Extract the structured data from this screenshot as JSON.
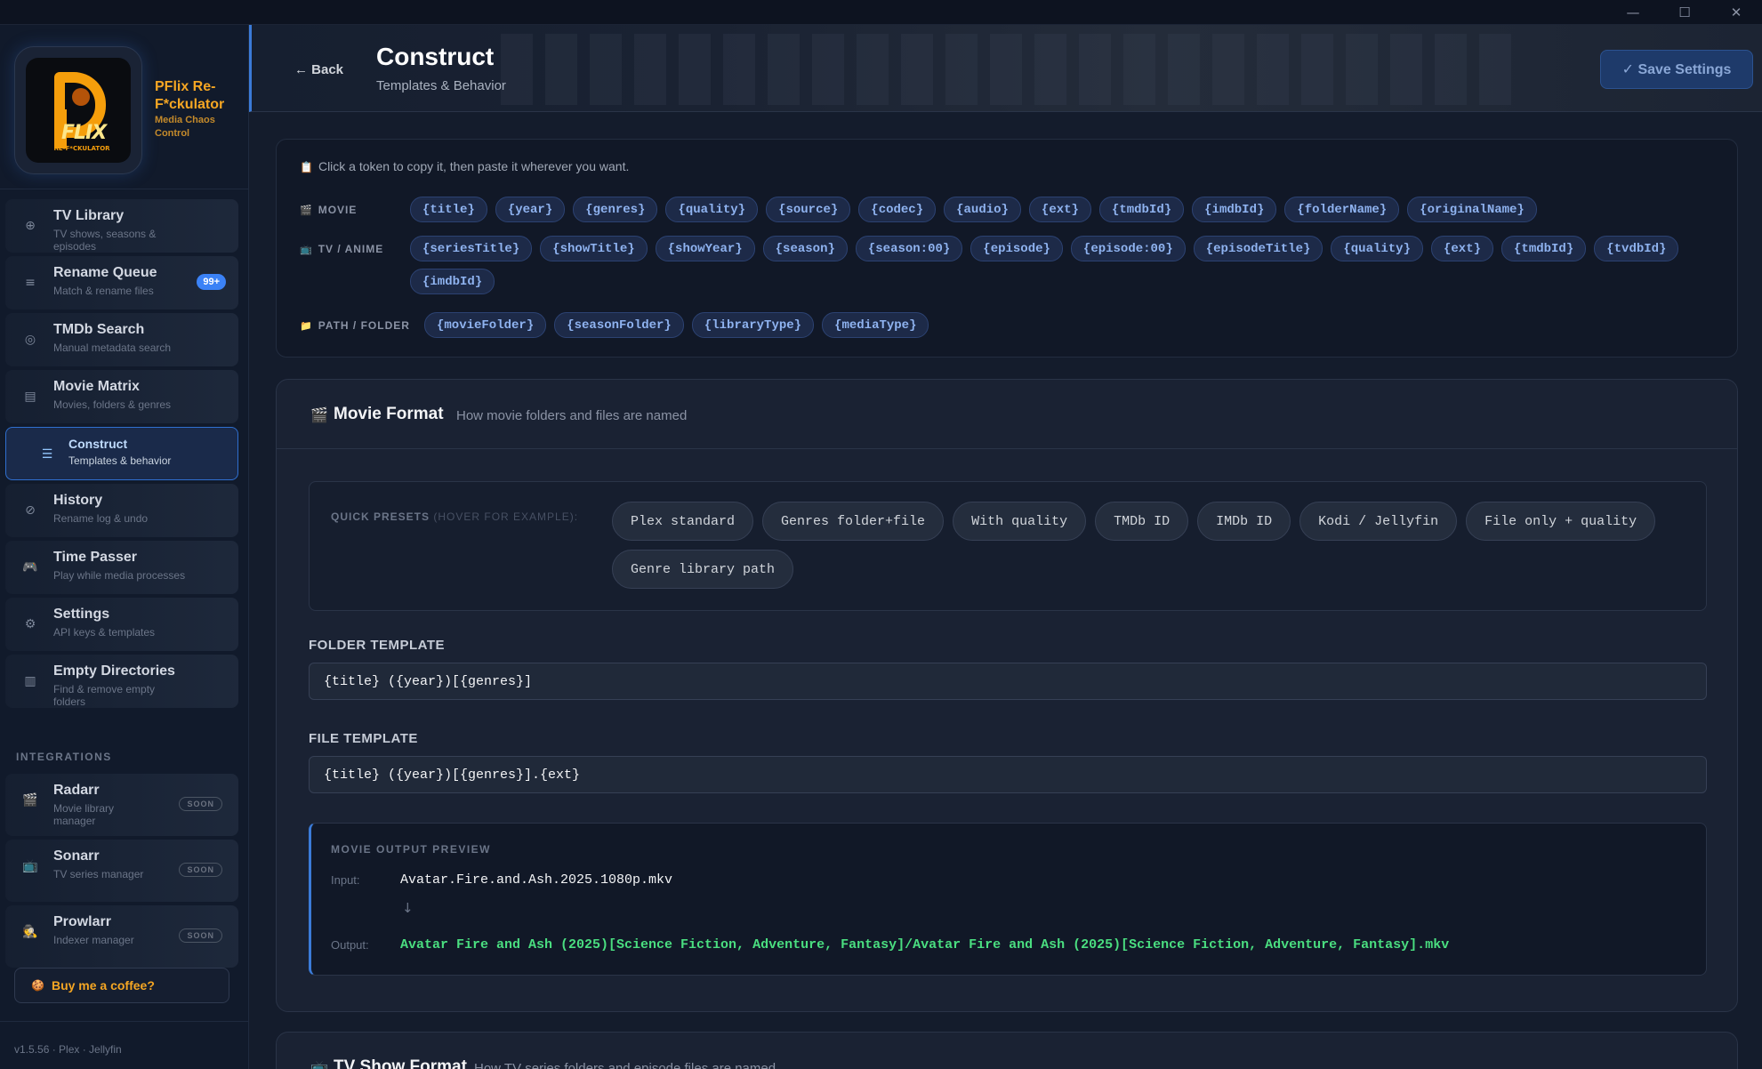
{
  "window": {
    "minimize": "—",
    "maximize": "☐",
    "close": "✕"
  },
  "brand": {
    "name": "PFlix Re-F*ckulator",
    "tagline": "Media Chaos Control",
    "logo_text": "FLIX",
    "logo_subtext": "RE-F*CKULATOR"
  },
  "nav": [
    {
      "label": "TV Library",
      "desc": "TV shows, seasons & episodes",
      "icon": "globe-icon",
      "glyph": "⊕"
    },
    {
      "label": "Rename Queue",
      "desc": "Match & rename files",
      "icon": "list-icon",
      "glyph": "≡",
      "badge": "99+"
    },
    {
      "label": "TMDb Search",
      "desc": "Manual metadata search",
      "icon": "target-icon",
      "glyph": "◎"
    },
    {
      "label": "Movie Matrix",
      "desc": "Movies, folders & genres",
      "icon": "grid-icon",
      "glyph": "▤"
    },
    {
      "label": "Construct",
      "desc": "Templates & behavior",
      "icon": "lines-icon",
      "glyph": "☰",
      "active": true
    },
    {
      "label": "History",
      "desc": "Rename log & undo",
      "icon": "clock-icon",
      "glyph": "⊘"
    },
    {
      "label": "Time Passer",
      "desc": "Play while media processes",
      "icon": "gamepad-icon",
      "glyph": "🎮"
    },
    {
      "label": "Settings",
      "desc": "API keys & templates",
      "icon": "gear-icon",
      "glyph": "⚙"
    },
    {
      "label": "Empty Directories",
      "desc": "Find & remove empty folders",
      "icon": "trash-icon",
      "glyph": "▥"
    }
  ],
  "integrations_label": "INTEGRATIONS",
  "integrations": [
    {
      "label": "Radarr",
      "desc": "Movie library manager",
      "icon": "clapper-icon",
      "glyph": "🎬",
      "tag": "SOON"
    },
    {
      "label": "Sonarr",
      "desc": "TV series manager",
      "icon": "tv-icon",
      "glyph": "📺",
      "tag": "SOON"
    },
    {
      "label": "Prowlarr",
      "desc": "Indexer manager",
      "icon": "detective-icon",
      "glyph": "🕵",
      "tag": "SOON"
    }
  ],
  "coffee": {
    "icon": "coffee-icon",
    "glyph": "🍪",
    "label": "Buy me a coffee?"
  },
  "footer": {
    "version": "v1.5.56 · Plex · Jellyfin"
  },
  "header": {
    "back": "← Back",
    "title": "Construct",
    "subtitle": "Templates & Behavior",
    "save": "✓ Save Settings"
  },
  "tokens": {
    "hint_icon": "📋",
    "hint": "Click a token to copy it, then paste it wherever you want.",
    "groups": [
      {
        "icon": "🎬",
        "label": "MOVIE",
        "items": [
          "{title}",
          "{year}",
          "{genres}",
          "{quality}",
          "{source}",
          "{codec}",
          "{audio}",
          "{ext}",
          "{tmdbId}",
          "{imdbId}",
          "{folderName}",
          "{originalName}"
        ]
      },
      {
        "icon": "📺",
        "label": "TV / ANIME",
        "items": [
          "{seriesTitle}",
          "{showTitle}",
          "{showYear}",
          "{season}",
          "{season:00}",
          "{episode}",
          "{episode:00}",
          "{episodeTitle}",
          "{quality}",
          "{ext}",
          "{tmdbId}",
          "{tvdbId}",
          "{imdbId}"
        ]
      },
      {
        "icon": "📁",
        "label": "PATH / FOLDER",
        "items": [
          "{movieFolder}",
          "{seasonFolder}",
          "{libraryType}",
          "{mediaType}"
        ]
      }
    ]
  },
  "movie_format": {
    "icon": "🎬",
    "title": "Movie Format",
    "subtitle": "How movie folders and files are named",
    "presets_label": "QUICK PRESETS",
    "presets_hint": "(HOVER FOR EXAMPLE):",
    "presets": [
      "Plex standard",
      "Genres folder+file",
      "With quality",
      "TMDb ID",
      "IMDb ID",
      "Kodi / Jellyfin",
      "File only + quality",
      "Genre library path"
    ],
    "folder_label": "FOLDER TEMPLATE",
    "folder_value": "{title} ({year})[{genres}]",
    "file_label": "FILE TEMPLATE",
    "file_value": "{title} ({year})[{genres}].{ext}",
    "preview": {
      "label": "MOVIE OUTPUT PREVIEW",
      "input_label": "Input:",
      "input": "Avatar.Fire.and.Ash.2025.1080p.mkv",
      "arrow": "↓",
      "output_label": "Output:",
      "output": "Avatar Fire and Ash (2025)[Science Fiction, Adventure, Fantasy]/Avatar Fire and Ash (2025)[Science Fiction, Adventure, Fantasy].mkv"
    }
  },
  "tv_format": {
    "icon": "📺",
    "title": "TV Show Format",
    "subtitle": "How TV series folders and episode files are named"
  },
  "colors": {
    "accent": "#3b82f6",
    "brand": "#f5a623",
    "output_green": "#4ade80",
    "token_text": "#8fb3f0"
  }
}
